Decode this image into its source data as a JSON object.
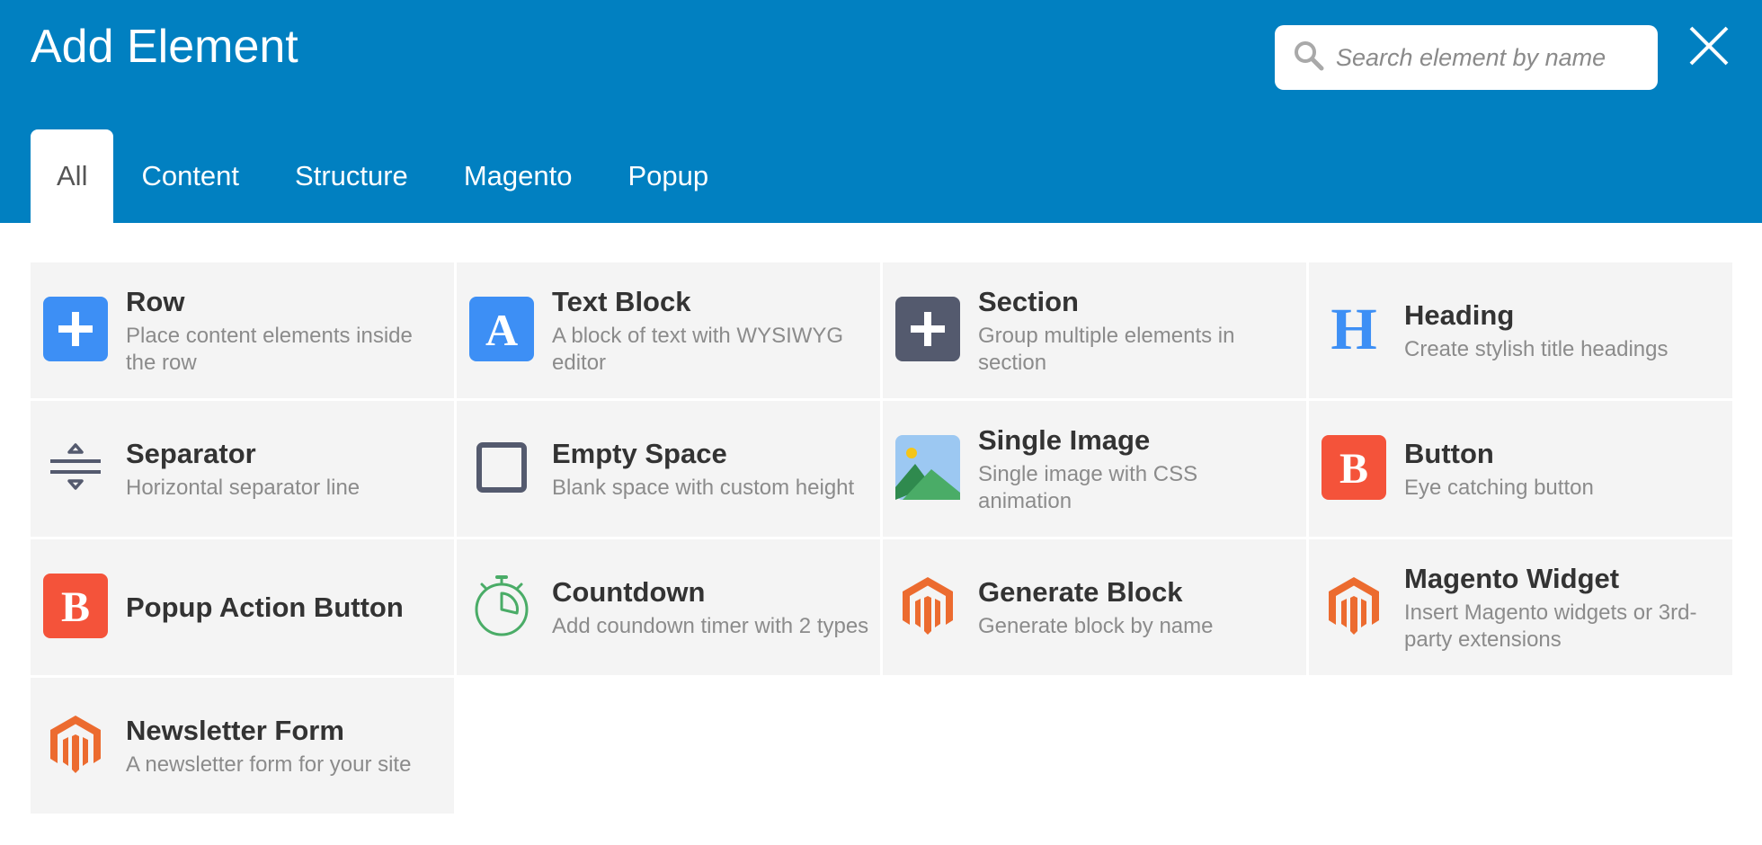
{
  "header": {
    "title": "Add Element",
    "search_placeholder": "Search element by name",
    "close_label": "Close"
  },
  "tabs": [
    {
      "label": "All",
      "active": true
    },
    {
      "label": "Content",
      "active": false
    },
    {
      "label": "Structure",
      "active": false
    },
    {
      "label": "Magento",
      "active": false
    },
    {
      "label": "Popup",
      "active": false
    }
  ],
  "elements": [
    {
      "title": "Row",
      "desc": "Place content elements inside the row",
      "icon": "plus-icon"
    },
    {
      "title": "Text Block",
      "desc": "A block of text with WYSIWYG editor",
      "icon": "letter-a-icon"
    },
    {
      "title": "Section",
      "desc": "Group multiple elements in section",
      "icon": "plus-icon"
    },
    {
      "title": "Heading",
      "desc": "Create stylish title headings",
      "icon": "letter-h-icon"
    },
    {
      "title": "Separator",
      "desc": "Horizontal separator line",
      "icon": "separator-icon"
    },
    {
      "title": "Empty Space",
      "desc": "Blank space with custom height",
      "icon": "square-icon"
    },
    {
      "title": "Single Image",
      "desc": "Single image with CSS animation",
      "icon": "image-icon"
    },
    {
      "title": "Button",
      "desc": "Eye catching button",
      "icon": "letter-b-icon"
    },
    {
      "title": "Popup Action Button",
      "desc": "",
      "icon": "letter-b-icon"
    },
    {
      "title": "Countdown",
      "desc": "Add coundown timer with 2 types",
      "icon": "stopwatch-icon"
    },
    {
      "title": "Generate Block",
      "desc": "Generate block by name",
      "icon": "magento-icon"
    },
    {
      "title": "Magento Widget",
      "desc": "Insert Magento widgets or 3rd-party extensions",
      "icon": "magento-icon"
    },
    {
      "title": "Newsletter Form",
      "desc": "A newsletter form for your site",
      "icon": "magento-icon"
    }
  ],
  "colors": {
    "header_bg": "#0180c1",
    "card_bg": "#f4f4f4",
    "row_icon": "#3d8ff5",
    "section_icon": "#545a6e",
    "button_icon": "#f4533a",
    "magento_orange": "#ec6b2f",
    "countdown_green": "#4aac67"
  }
}
